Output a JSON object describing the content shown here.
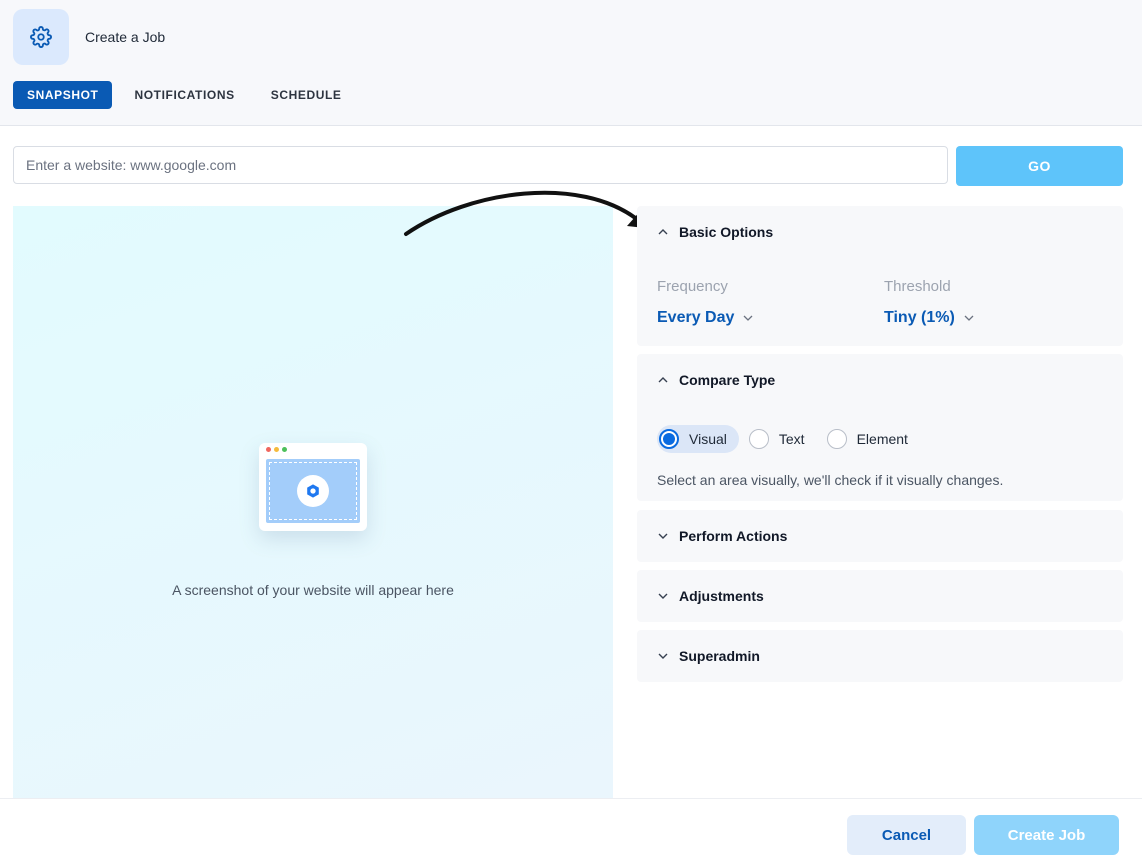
{
  "header": {
    "title": "Create a Job",
    "logo_icon": "gear-icon",
    "tabs": [
      {
        "label": "SNAPSHOT",
        "active": true
      },
      {
        "label": "NOTIFICATIONS",
        "active": false
      },
      {
        "label": "SCHEDULE",
        "active": false
      }
    ]
  },
  "url_bar": {
    "placeholder": "Enter a website: www.google.com",
    "value": "",
    "go_label": "GO"
  },
  "preview": {
    "caption": "A screenshot of your website will appear here",
    "illustration_icon": "camera-icon"
  },
  "panels": {
    "basic_options": {
      "title": "Basic Options",
      "expanded": true,
      "frequency_label": "Frequency",
      "frequency_value": "Every Day",
      "threshold_label": "Threshold",
      "threshold_value": "Tiny (1%)"
    },
    "compare_type": {
      "title": "Compare Type",
      "expanded": true,
      "options": [
        {
          "label": "Visual",
          "selected": true
        },
        {
          "label": "Text",
          "selected": false
        },
        {
          "label": "Element",
          "selected": false
        }
      ],
      "description": "Select an area visually, we'll check if it visually changes."
    },
    "perform_actions": {
      "title": "Perform Actions",
      "expanded": false
    },
    "adjustments": {
      "title": "Adjustments",
      "expanded": false
    },
    "superadmin": {
      "title": "Superadmin",
      "expanded": false
    }
  },
  "footer": {
    "cancel_label": "Cancel",
    "create_label": "Create Job"
  },
  "colors": {
    "primary": "#0a5ab4",
    "go_button": "#5ec4fa",
    "create_button": "#8fd4fb",
    "radio_selected": "#0a6be0"
  }
}
